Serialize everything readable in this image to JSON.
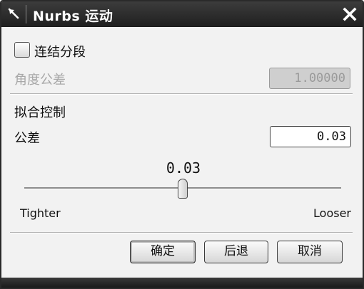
{
  "window": {
    "title": "Nurbs 运动",
    "close_label": "✕"
  },
  "options": {
    "connect_segments_label": "连结分段",
    "connect_segments_checked": false,
    "angle_tolerance_label": "角度公差",
    "angle_tolerance_value": "1.00000",
    "angle_tolerance_enabled": false
  },
  "fit_control": {
    "section_label": "拟合控制",
    "tolerance_label": "公差",
    "tolerance_value": "0.03",
    "slider_value_text": "0.03",
    "slider_position": 0.5,
    "slider_min_label": "Tighter",
    "slider_max_label": "Looser"
  },
  "buttons": {
    "ok": "确定",
    "back": "后退",
    "cancel": "取消"
  },
  "icons": {
    "title_icon": "arrow-cursor-icon",
    "close_icon": "close-icon"
  },
  "colors": {
    "titlebar": "#2a2a2a",
    "dialog_bg": "#f2f2f2",
    "disabled_text": "#a8a8a8"
  }
}
